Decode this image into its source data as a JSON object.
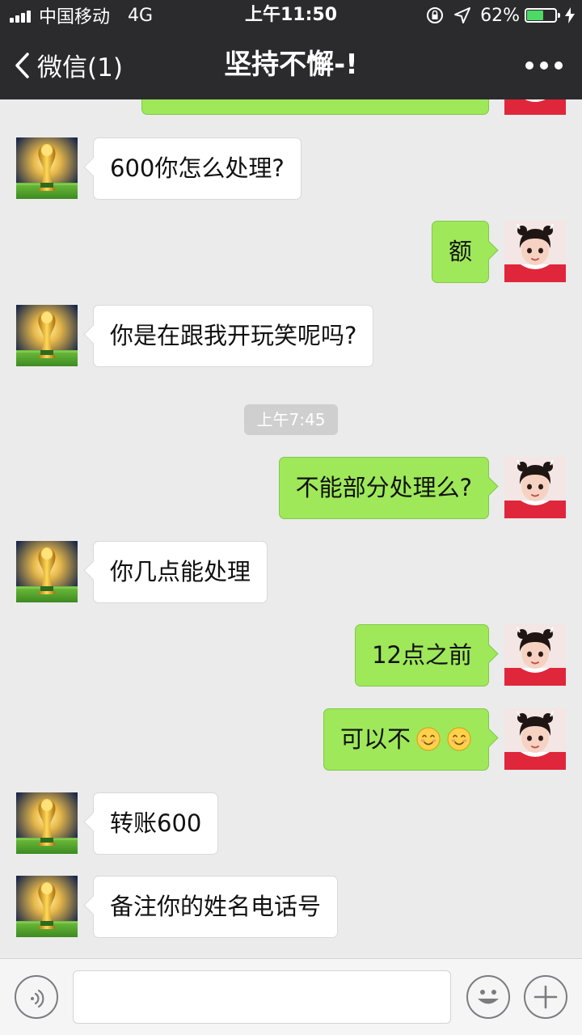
{
  "status_bar": {
    "carrier": "中国移动",
    "network": "4G",
    "time": "上午11:50",
    "battery_percent": "62%",
    "battery_level": 0.62
  },
  "nav": {
    "back_label": "微信(1)",
    "title": "坚持不懈-!"
  },
  "colors": {
    "bar_bg": "#2b2b2d",
    "chat_bg": "#ebebeb",
    "outgoing_bubble": "#9ee85a",
    "incoming_bubble": "#ffffff",
    "timestamp_bg": "#cfcfcf"
  },
  "messages": [
    {
      "side": "in",
      "text": "600你怎么处理?"
    },
    {
      "side": "out",
      "text": "额"
    },
    {
      "side": "in",
      "text": "你是在跟我开玩笑呢吗?"
    },
    {
      "side": "out",
      "text": "不能部分处理么?"
    },
    {
      "side": "in",
      "text": "你几点能处理"
    },
    {
      "side": "out",
      "text": "12点之前"
    },
    {
      "side": "out",
      "text": "可以不",
      "emoji": [
        "smile-emoji",
        "smile-emoji"
      ]
    },
    {
      "side": "in",
      "text": "转账600"
    },
    {
      "side": "in",
      "text": "备注你的姓名电话号"
    }
  ],
  "timestamp": "上午7:45",
  "avatars": {
    "incoming": "world-cup-trophy-avatar",
    "outgoing": "girl-photo-avatar"
  },
  "input_bar": {
    "voice_icon": "voice-icon",
    "emoji_icon": "emoji-face-icon",
    "plus_icon": "plus-icon",
    "input_value": ""
  }
}
